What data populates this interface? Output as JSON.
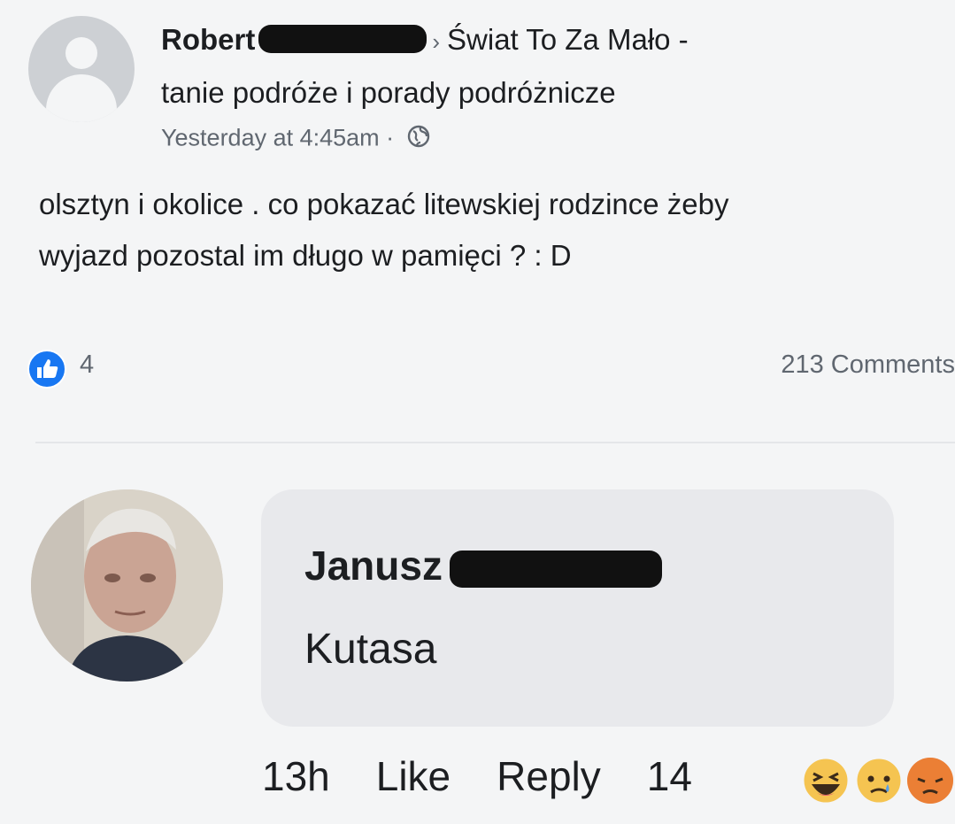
{
  "post": {
    "author": "Robert",
    "group": "Świat To Za Mało -",
    "group_line2": "tanie podróże i porady podróżnicze",
    "timestamp": "Yesterday at 4:45am",
    "separator": " · ",
    "text_line1": "olsztyn i okolice . co pokazać litewskiej rodzince żeby",
    "text_line2": "wyjazd pozostal im długo w pamięci ? : D",
    "like_count": "4",
    "comments_count": "213 Comments",
    "like_icon": "thumbs-up-icon",
    "privacy_icon": "globe-icon"
  },
  "comment": {
    "author": "Janusz",
    "text": "Kutasa",
    "time": "13h",
    "like_label": "Like",
    "reply_label": "Reply",
    "reaction_count": "14",
    "reaction_icons": [
      "haha-reaction-icon",
      "sad-reaction-icon",
      "angry-reaction-icon"
    ]
  },
  "colors": {
    "background": "#f4f5f6",
    "bubble": "#e8e9ec",
    "secondary_text": "#606770",
    "like_blue": "#1877f2"
  }
}
